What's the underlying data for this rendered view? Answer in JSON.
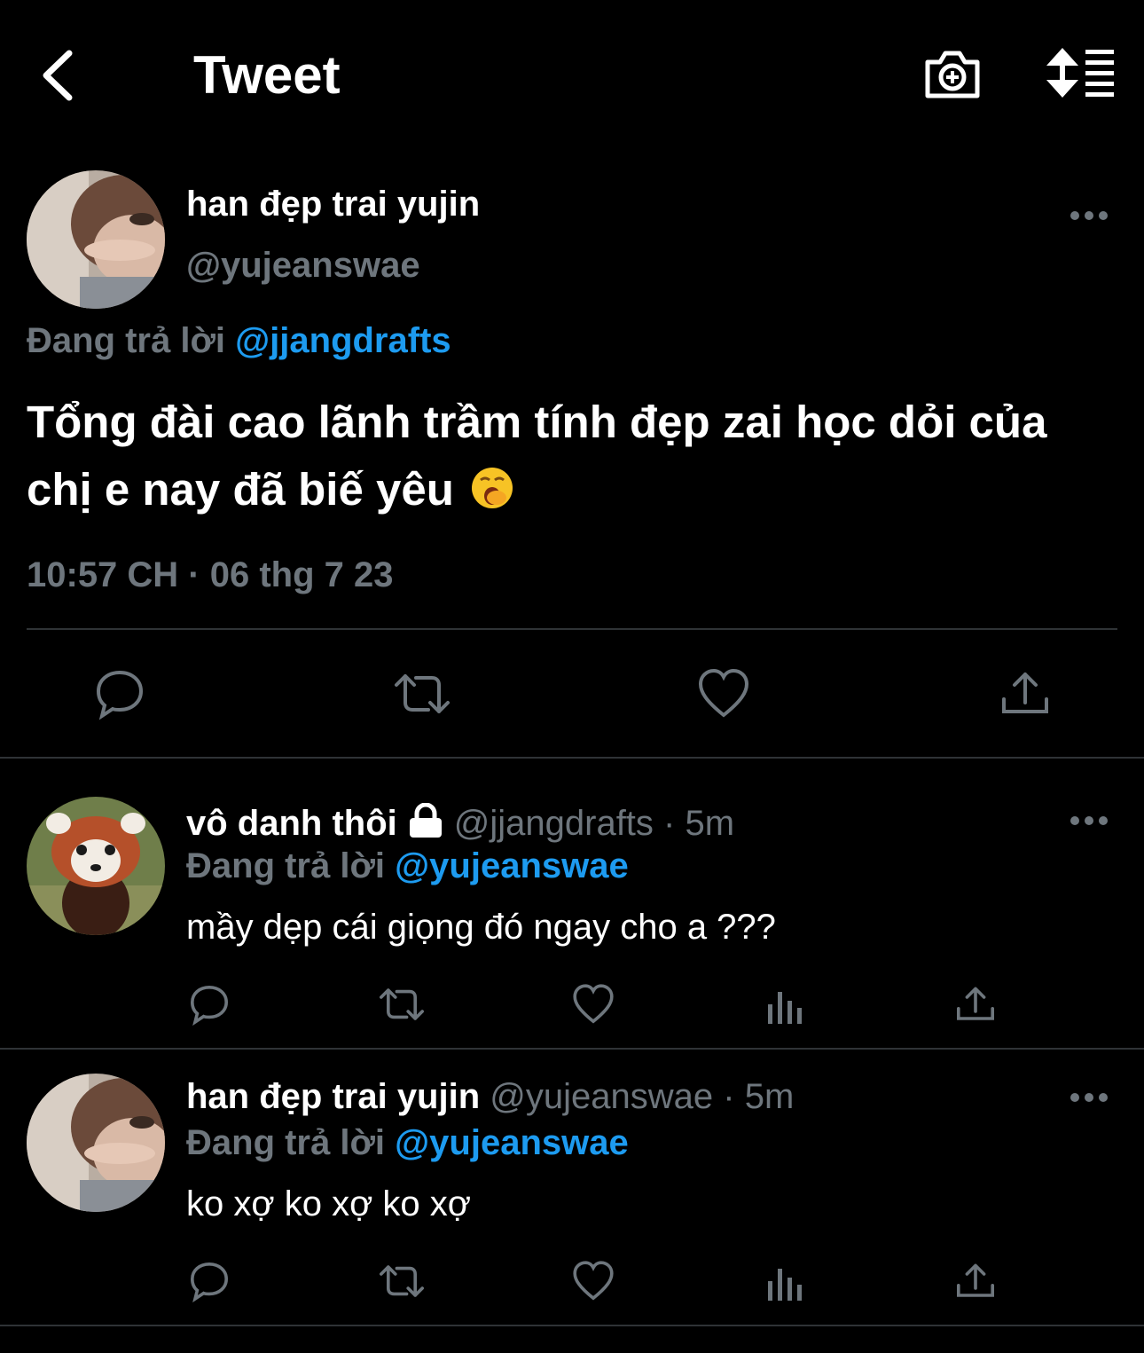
{
  "header": {
    "title": "Tweet"
  },
  "main_tweet": {
    "name": "han đẹp trai yujin",
    "handle": "@yujeanswae",
    "replying_label": "Đang trả lời",
    "replying_to": "@jjangdrafts",
    "text": "Tổng đài cao lãnh trầm tính đẹp zai học dỏi của chị e nay đã biế yêu",
    "emoji": "yawning-face",
    "timestamp": "10:57 CH · 06 thg 7 23",
    "actions": [
      "reply-icon",
      "retweet-icon",
      "like-icon",
      "share-icon"
    ]
  },
  "replies": [
    {
      "name": "vô danh thôi",
      "protected": true,
      "handle": "@jjangdrafts",
      "time": "· 5m",
      "replying_label": "Đang trả lời",
      "replying_to": "@yujeanswae",
      "text": "mầy dẹp cái giọng đó ngay cho a ???"
    },
    {
      "name": "han đẹp trai yujin",
      "protected": false,
      "handle": "@yujeanswae",
      "time": "· 5m",
      "replying_label": "Đang trả lời",
      "replying_to": "@yujeanswae",
      "text": "ko xợ ko xợ ko xợ"
    }
  ],
  "colors": {
    "background": "#000000",
    "text": "#e7e9ea",
    "secondary": "#6e767d",
    "accent": "#1d9bf0",
    "divider": "#2f3336"
  }
}
